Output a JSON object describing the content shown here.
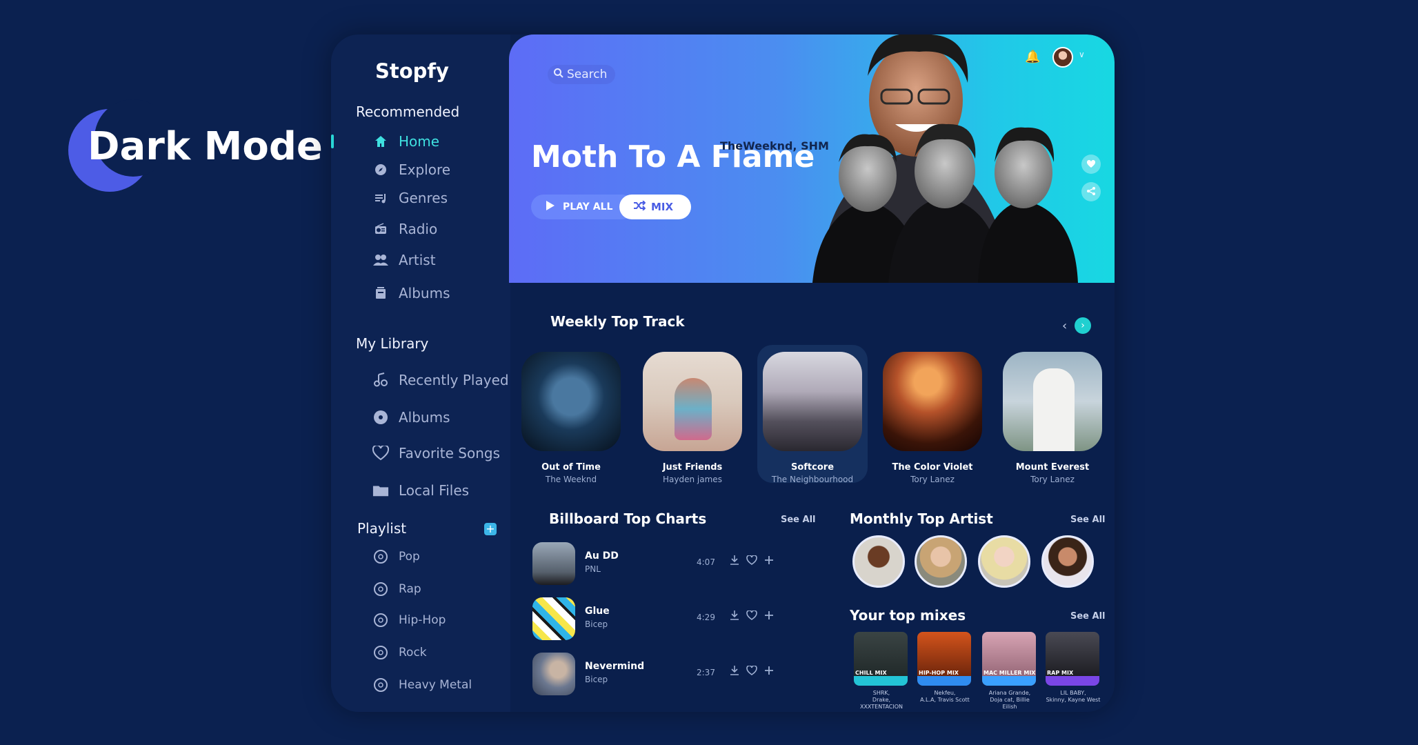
{
  "badge": {
    "label": "Dark Mode"
  },
  "app": {
    "brand": "Stopfy"
  },
  "sidebar": {
    "recommended_title": "Recommended",
    "recommended": [
      {
        "label": "Home",
        "icon": "home-icon"
      },
      {
        "label": "Explore",
        "icon": "compass-icon"
      },
      {
        "label": "Genres",
        "icon": "queue-icon"
      },
      {
        "label": "Radio",
        "icon": "radio-icon"
      },
      {
        "label": "Artist",
        "icon": "people-icon"
      },
      {
        "label": "Albums",
        "icon": "album-icon"
      }
    ],
    "library_title": "My Library",
    "library": [
      {
        "label": "Recently Played",
        "icon": "music-note-icon"
      },
      {
        "label": "Albums",
        "icon": "disc-icon"
      },
      {
        "label": "Favorite Songs",
        "icon": "heart-icon"
      },
      {
        "label": "Local Files",
        "icon": "folder-icon"
      }
    ],
    "playlist_title": "Playlist",
    "playlist_add": "+",
    "playlists": [
      "Pop",
      "Rap",
      "Hip-Hop",
      "Rock",
      "Heavy Metal"
    ]
  },
  "hero": {
    "search_placeholder": "Search",
    "title": "Moth To A Flame",
    "artists": "TheWeeknd, SHM",
    "play_all": "PLAY ALL",
    "mix": "MIX"
  },
  "weekly": {
    "title": "Weekly Top Track",
    "tracks": [
      {
        "title": "Out of Time",
        "artist": "The Weeknd"
      },
      {
        "title": "Just Friends",
        "artist": "Hayden james"
      },
      {
        "title": "Softcore",
        "artist": "The Neighbourhood"
      },
      {
        "title": "The Color Violet",
        "artist": "Tory Lanez"
      },
      {
        "title": "Mount Everest",
        "artist": "Tory Lanez"
      }
    ]
  },
  "billboard": {
    "title": "Billboard Top Charts",
    "see_all": "See All",
    "rows": [
      {
        "name": "Au DD",
        "artist": "PNL",
        "duration": "4:07"
      },
      {
        "name": "Glue",
        "artist": "Bicep",
        "duration": "4:29"
      },
      {
        "name": "Nevermind",
        "artist": "Bicep",
        "duration": "2:37"
      }
    ]
  },
  "monthly": {
    "title": "Monthly Top Artist",
    "see_all": "See All"
  },
  "mixes": {
    "title": "Your top mixes",
    "see_all": "See All",
    "items": [
      {
        "label": "CHILL MIX",
        "artists1": "SHRK,",
        "artists2": "Drake, XXXTENTACION",
        "color": "#23c4d6"
      },
      {
        "label": "HIP-HOP MIX",
        "artists1": "Nekfeu,",
        "artists2": "A.L.A, Travis Scott",
        "color": "#2f8cf0"
      },
      {
        "label": "MAC MILLER MIX",
        "artists1": "Ariana Grande,",
        "artists2": "Doja cat, Billie Eilish",
        "color": "#3aa0ff"
      },
      {
        "label": "RAP MIX",
        "artists1": "LIL BABY,",
        "artists2": "Skinny, Kayne West",
        "color": "#7a46e6"
      }
    ]
  },
  "colors": {
    "accent": "#29d6d6",
    "background": "#0b2150",
    "brand_purple": "#4d5ce6"
  }
}
